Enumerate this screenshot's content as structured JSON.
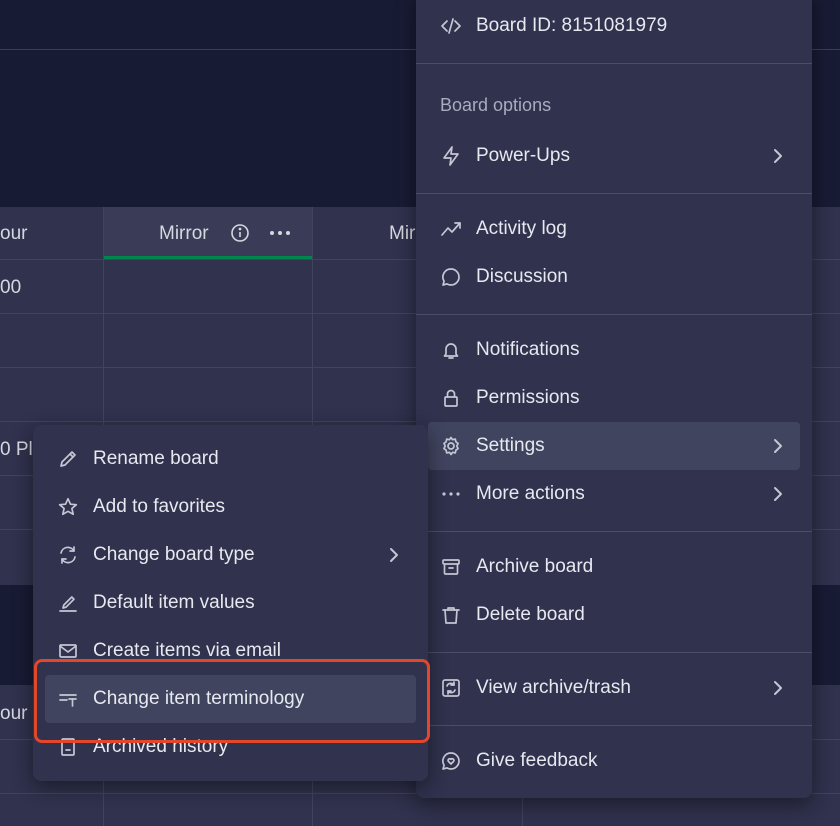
{
  "board": {
    "header_cells": [
      "our",
      "Mirror",
      "Mir"
    ],
    "row_cells": [
      "00",
      "0 Pl"
    ],
    "lower_header_cell": "our"
  },
  "main_menu": {
    "board_id_label": "Board ID: 8151081979",
    "section_title": "Board options",
    "items": [
      {
        "label": "Power-Ups",
        "icon": "bolt-icon"
      },
      {
        "label": "Activity log",
        "icon": "activity-icon"
      },
      {
        "label": "Discussion",
        "icon": "chat-icon"
      },
      {
        "label": "Notifications",
        "icon": "bell-icon"
      },
      {
        "label": "Permissions",
        "icon": "lock-icon"
      },
      {
        "label": "Settings",
        "icon": "gear-icon"
      },
      {
        "label": "More actions",
        "icon": "more-icon"
      },
      {
        "label": "Archive board",
        "icon": "archive-icon"
      },
      {
        "label": "Delete board",
        "icon": "trash-icon"
      },
      {
        "label": "View archive/trash",
        "icon": "archive-trash-icon"
      },
      {
        "label": "Give feedback",
        "icon": "feedback-icon"
      }
    ]
  },
  "sub_menu": {
    "items": [
      {
        "label": "Rename board",
        "icon": "pencil-icon"
      },
      {
        "label": "Add to favorites",
        "icon": "star-icon"
      },
      {
        "label": "Change board type",
        "icon": "switch-icon"
      },
      {
        "label": "Default item values",
        "icon": "edit-box-icon"
      },
      {
        "label": "Create items via email",
        "icon": "mail-icon"
      },
      {
        "label": "Change item terminology",
        "icon": "terminology-icon"
      },
      {
        "label": "Archived history",
        "icon": "archived-history-icon"
      }
    ]
  },
  "colors": {
    "background": "#181b34",
    "menu": "#30324e",
    "active_item": "#41445f",
    "highlight": "#e2472a",
    "mirror_underline": "#00854d"
  }
}
